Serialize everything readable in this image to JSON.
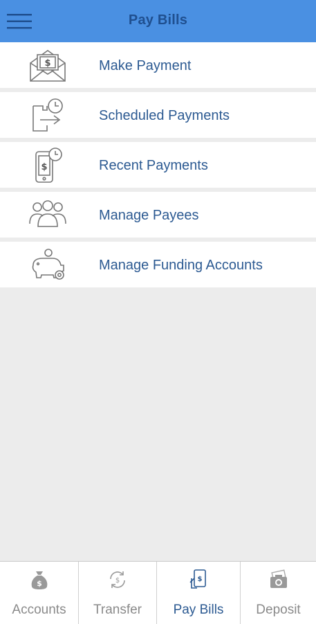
{
  "header": {
    "title": "Pay Bills",
    "menu_icon": "hamburger-menu-icon"
  },
  "menu": {
    "items": [
      {
        "label": "Make Payment",
        "icon": "envelope-dollar-icon"
      },
      {
        "label": "Scheduled Payments",
        "icon": "calendar-clock-arrow-icon"
      },
      {
        "label": "Recent Payments",
        "icon": "phone-dollar-clock-icon"
      },
      {
        "label": "Manage Payees",
        "icon": "people-group-icon"
      },
      {
        "label": "Manage Funding Accounts",
        "icon": "piggy-bank-gear-icon"
      }
    ]
  },
  "tabbar": {
    "tabs": [
      {
        "label": "Accounts",
        "icon": "money-bag-icon",
        "active": false
      },
      {
        "label": "Transfer",
        "icon": "transfer-cycle-icon",
        "active": false
      },
      {
        "label": "Pay Bills",
        "icon": "phone-bill-icon",
        "active": true
      },
      {
        "label": "Deposit",
        "icon": "camera-check-icon",
        "active": false
      }
    ]
  },
  "colors": {
    "header_bg": "#4a90e2",
    "header_text": "#1f4f8f",
    "item_text": "#2c5a92",
    "background": "#ececec",
    "tab_inactive": "#8a8a8a",
    "tab_active": "#2c5a92"
  }
}
